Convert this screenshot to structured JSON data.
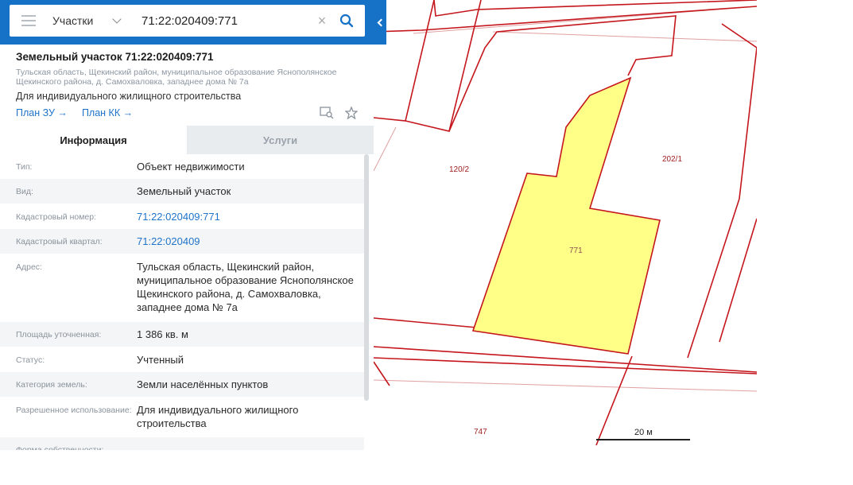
{
  "search": {
    "type_label": "Участки",
    "query": "71:22:020409:771",
    "clear_glyph": "×"
  },
  "card": {
    "title": "Земельный участок 71:22:020409:771",
    "address_short": "Тульская область, Щекинский район, муниципальное образование Яснополянское Щекинского района, д. Самохваловка, западнее дома № 7а",
    "purpose": "Для индивидуального жилищного строительства",
    "link_plan_zu": "План ЗУ →",
    "link_plan_kk": "План КК →"
  },
  "tabs": {
    "info": "Информация",
    "services": "Услуги"
  },
  "rows": [
    {
      "label": "Тип:",
      "value": "Объект недвижимости"
    },
    {
      "label": "Вид:",
      "value": "Земельный участок"
    },
    {
      "label": "Кадастровый номер:",
      "value": "71:22:020409:771"
    },
    {
      "label": "Кадастровый квартал:",
      "value": "71:22:020409"
    },
    {
      "label": "Адрес:",
      "value": "Тульская область, Щекинский район, муниципальное образование Яснополянское Щекинского района, д. Самохваловка, западнее дома № 7а"
    },
    {
      "label": "Площадь уточненная:",
      "value": "1 386 кв. м"
    },
    {
      "label": "Статус:",
      "value": "Учтенный"
    },
    {
      "label": "Категория земель:",
      "value": "Земли населённых пунктов"
    },
    {
      "label": "Разрешенное использование:",
      "value": "Для индивидуального жилищного строительства"
    },
    {
      "label": "Форма собственности:",
      "value": ""
    }
  ],
  "map": {
    "parcel_label": "771",
    "label_120_2": "120/2",
    "label_202_1": "202/1",
    "label_747": "747",
    "scale_label": "20 м",
    "parcel_fill": "#ffff88",
    "boundary_color": "#c4161c"
  }
}
